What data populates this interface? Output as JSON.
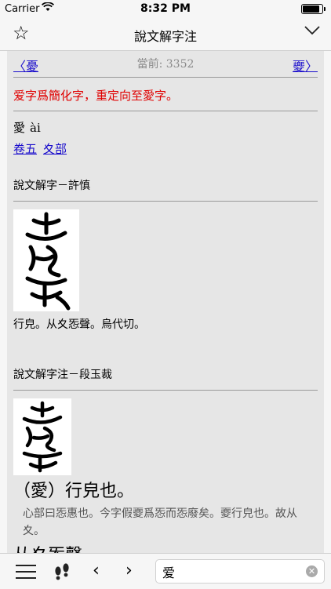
{
  "status": {
    "carrier": "Carrier",
    "time": "8:32 PM",
    "battery_level": 0.95
  },
  "nav": {
    "title": "說文解字注"
  },
  "pager": {
    "prev_label": "〈憂",
    "current_label": "當前: 3352",
    "next_label": "夒〉"
  },
  "redirect_text": "爱字爲簡化字，重定向至愛字。",
  "entry": {
    "character": "愛",
    "pinyin": "ài",
    "links": [
      "卷五",
      "夊部"
    ]
  },
  "section1": {
    "heading": "說文解字－許慎",
    "gloss": "行皃。从夊㤅聲。烏代切。"
  },
  "section2": {
    "heading": "說文解字注－段玉裁",
    "main": "（愛）行皃也。",
    "note": "心部曰㤅惠也。今字假夒爲㤅而㤅廢矣。夒行皃也。故从夊。",
    "main2": "从夊㤅聲。"
  },
  "search": {
    "value": "爱"
  }
}
